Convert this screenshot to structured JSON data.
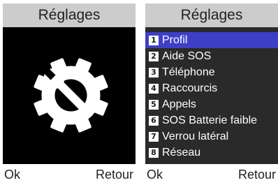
{
  "left_screen": {
    "title": "Réglages",
    "icon": "settings-gear-wrench-icon",
    "softkeys": {
      "left": "Ok",
      "right": "Retour"
    }
  },
  "right_screen": {
    "title": "Réglages",
    "selected_index": 0,
    "menu": [
      {
        "number": "1",
        "label": "Profil"
      },
      {
        "number": "2",
        "label": "Aide SOS"
      },
      {
        "number": "3",
        "label": "Téléphone"
      },
      {
        "number": "4",
        "label": "Raccourcis"
      },
      {
        "number": "5",
        "label": "Appels"
      },
      {
        "number": "6",
        "label": "SOS Batterie faible"
      },
      {
        "number": "7",
        "label": "Verrou latéral"
      },
      {
        "number": "8",
        "label": "Réseau"
      }
    ],
    "softkeys": {
      "left": "Ok",
      "right": "Retour"
    }
  },
  "colors": {
    "header_bg": "#cccccc",
    "selection": "#3d3fc7",
    "menu_bg": "#2a2a2a",
    "icon_bg": "#000000"
  }
}
